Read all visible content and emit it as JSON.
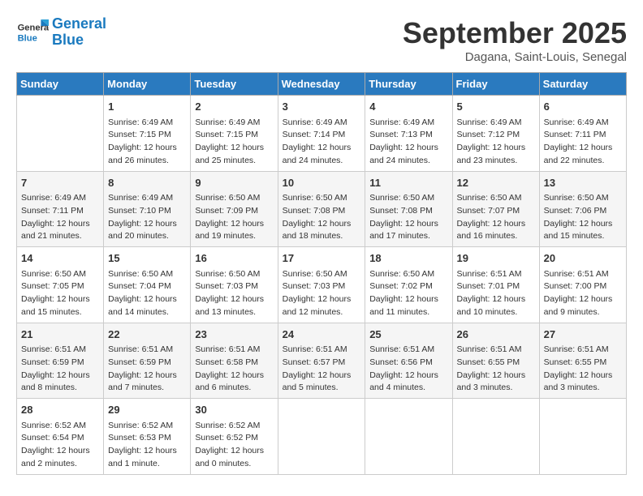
{
  "header": {
    "logo": "GeneralBlue",
    "month": "September 2025",
    "location": "Dagana, Saint-Louis, Senegal"
  },
  "days_of_week": [
    "Sunday",
    "Monday",
    "Tuesday",
    "Wednesday",
    "Thursday",
    "Friday",
    "Saturday"
  ],
  "weeks": [
    [
      {
        "day": "",
        "info": ""
      },
      {
        "day": "1",
        "info": "Sunrise: 6:49 AM\nSunset: 7:15 PM\nDaylight: 12 hours\nand 26 minutes."
      },
      {
        "day": "2",
        "info": "Sunrise: 6:49 AM\nSunset: 7:15 PM\nDaylight: 12 hours\nand 25 minutes."
      },
      {
        "day": "3",
        "info": "Sunrise: 6:49 AM\nSunset: 7:14 PM\nDaylight: 12 hours\nand 24 minutes."
      },
      {
        "day": "4",
        "info": "Sunrise: 6:49 AM\nSunset: 7:13 PM\nDaylight: 12 hours\nand 24 minutes."
      },
      {
        "day": "5",
        "info": "Sunrise: 6:49 AM\nSunset: 7:12 PM\nDaylight: 12 hours\nand 23 minutes."
      },
      {
        "day": "6",
        "info": "Sunrise: 6:49 AM\nSunset: 7:11 PM\nDaylight: 12 hours\nand 22 minutes."
      }
    ],
    [
      {
        "day": "7",
        "info": "Sunrise: 6:49 AM\nSunset: 7:11 PM\nDaylight: 12 hours\nand 21 minutes."
      },
      {
        "day": "8",
        "info": "Sunrise: 6:49 AM\nSunset: 7:10 PM\nDaylight: 12 hours\nand 20 minutes."
      },
      {
        "day": "9",
        "info": "Sunrise: 6:50 AM\nSunset: 7:09 PM\nDaylight: 12 hours\nand 19 minutes."
      },
      {
        "day": "10",
        "info": "Sunrise: 6:50 AM\nSunset: 7:08 PM\nDaylight: 12 hours\nand 18 minutes."
      },
      {
        "day": "11",
        "info": "Sunrise: 6:50 AM\nSunset: 7:08 PM\nDaylight: 12 hours\nand 17 minutes."
      },
      {
        "day": "12",
        "info": "Sunrise: 6:50 AM\nSunset: 7:07 PM\nDaylight: 12 hours\nand 16 minutes."
      },
      {
        "day": "13",
        "info": "Sunrise: 6:50 AM\nSunset: 7:06 PM\nDaylight: 12 hours\nand 15 minutes."
      }
    ],
    [
      {
        "day": "14",
        "info": "Sunrise: 6:50 AM\nSunset: 7:05 PM\nDaylight: 12 hours\nand 15 minutes."
      },
      {
        "day": "15",
        "info": "Sunrise: 6:50 AM\nSunset: 7:04 PM\nDaylight: 12 hours\nand 14 minutes."
      },
      {
        "day": "16",
        "info": "Sunrise: 6:50 AM\nSunset: 7:03 PM\nDaylight: 12 hours\nand 13 minutes."
      },
      {
        "day": "17",
        "info": "Sunrise: 6:50 AM\nSunset: 7:03 PM\nDaylight: 12 hours\nand 12 minutes."
      },
      {
        "day": "18",
        "info": "Sunrise: 6:50 AM\nSunset: 7:02 PM\nDaylight: 12 hours\nand 11 minutes."
      },
      {
        "day": "19",
        "info": "Sunrise: 6:51 AM\nSunset: 7:01 PM\nDaylight: 12 hours\nand 10 minutes."
      },
      {
        "day": "20",
        "info": "Sunrise: 6:51 AM\nSunset: 7:00 PM\nDaylight: 12 hours\nand 9 minutes."
      }
    ],
    [
      {
        "day": "21",
        "info": "Sunrise: 6:51 AM\nSunset: 6:59 PM\nDaylight: 12 hours\nand 8 minutes."
      },
      {
        "day": "22",
        "info": "Sunrise: 6:51 AM\nSunset: 6:59 PM\nDaylight: 12 hours\nand 7 minutes."
      },
      {
        "day": "23",
        "info": "Sunrise: 6:51 AM\nSunset: 6:58 PM\nDaylight: 12 hours\nand 6 minutes."
      },
      {
        "day": "24",
        "info": "Sunrise: 6:51 AM\nSunset: 6:57 PM\nDaylight: 12 hours\nand 5 minutes."
      },
      {
        "day": "25",
        "info": "Sunrise: 6:51 AM\nSunset: 6:56 PM\nDaylight: 12 hours\nand 4 minutes."
      },
      {
        "day": "26",
        "info": "Sunrise: 6:51 AM\nSunset: 6:55 PM\nDaylight: 12 hours\nand 3 minutes."
      },
      {
        "day": "27",
        "info": "Sunrise: 6:51 AM\nSunset: 6:55 PM\nDaylight: 12 hours\nand 3 minutes."
      }
    ],
    [
      {
        "day": "28",
        "info": "Sunrise: 6:52 AM\nSunset: 6:54 PM\nDaylight: 12 hours\nand 2 minutes."
      },
      {
        "day": "29",
        "info": "Sunrise: 6:52 AM\nSunset: 6:53 PM\nDaylight: 12 hours\nand 1 minute."
      },
      {
        "day": "30",
        "info": "Sunrise: 6:52 AM\nSunset: 6:52 PM\nDaylight: 12 hours\nand 0 minutes."
      },
      {
        "day": "",
        "info": ""
      },
      {
        "day": "",
        "info": ""
      },
      {
        "day": "",
        "info": ""
      },
      {
        "day": "",
        "info": ""
      }
    ]
  ]
}
